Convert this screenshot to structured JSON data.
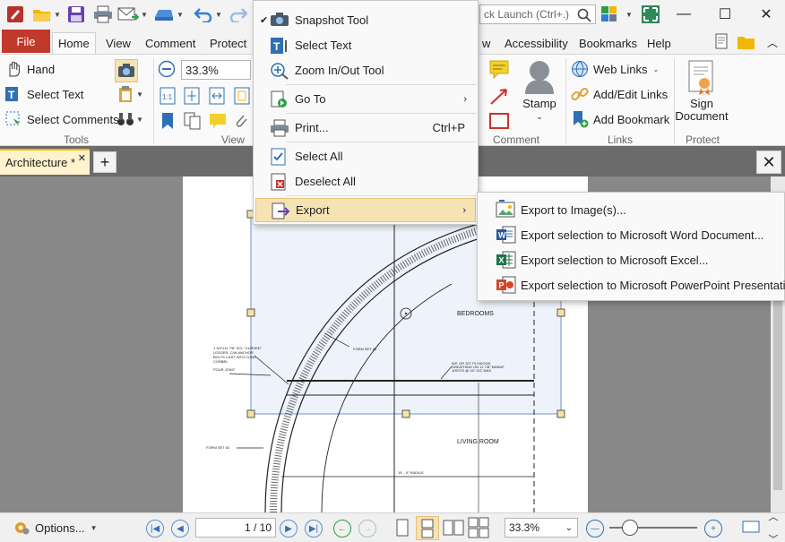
{
  "search": {
    "placeholder": "ck Launch (Ctrl+.)"
  },
  "tabs": {
    "file": "File",
    "items": [
      "Home",
      "View",
      "Comment",
      "Protect",
      "w",
      "Accessibility",
      "Bookmarks",
      "Help"
    ]
  },
  "ribbon": {
    "tools": {
      "hand": "Hand",
      "select_text": "Select Text",
      "select_comments": "Select Comments",
      "label": "Tools"
    },
    "view": {
      "zoom_value": "33.3%",
      "label": "View"
    },
    "comment": {
      "stamp": "Stamp",
      "label": "Comment"
    },
    "links": {
      "web_links": "Web Links",
      "add_edit_links": "Add/Edit Links",
      "add_bookmark": "Add Bookmark",
      "label": "Links"
    },
    "protect": {
      "sign_line1": "Sign",
      "sign_line2": "Document",
      "label": "Protect"
    }
  },
  "document": {
    "tab_title": "Architecture *"
  },
  "context_menu": {
    "snapshot_tool": "Snapshot Tool",
    "select_text": "Select Text",
    "zoom_tool": "Zoom In/Out Tool",
    "go_to": "Go To",
    "print": "Print...",
    "print_shortcut": "Ctrl+P",
    "select_all": "Select All",
    "deselect_all": "Deselect All",
    "export": "Export"
  },
  "export_menu": {
    "image": "Export to Image(s)...",
    "word": "Export selection to Microsoft Word Document...",
    "excel": "Export selection to Microsoft Excel...",
    "powerpoint": "Export selection to Microsoft PowerPoint Presentation..."
  },
  "drawing": {
    "bedrooms": "BEDROOMS",
    "living_room": "LIVING ROOM",
    "form_set_top": "FORM SET #3",
    "form_set_left": "FORM SET #2",
    "note_left_1": "1 3/4\"x11 7/8\" SCL \"CURVED\"",
    "note_left_2": "LEDGER, C/W ANCHOR",
    "note_left_3": "BOLTS CAST INTO CONC",
    "note_left_4": "CORBEL",
    "pour_joint": "POUR JOINT",
    "plywood_1": "5/8\" OR 3/4\" PLYWOOD",
    "plywood_2": "SHEATHING ON 11 7/8\" MANUF",
    "plywood_3": "JOISTS @ 16\" O/C MAX",
    "radius": "19' - 0\" RADIUS"
  },
  "status": {
    "options": "Options...",
    "page_display": "1 / 10",
    "zoom_value": "33.3%"
  },
  "colors": {
    "file_tab": "#c0392b",
    "doc_tab": "#fff2cc",
    "menu_highlight": "#f6e3b4",
    "selection": "#eef3fb"
  }
}
